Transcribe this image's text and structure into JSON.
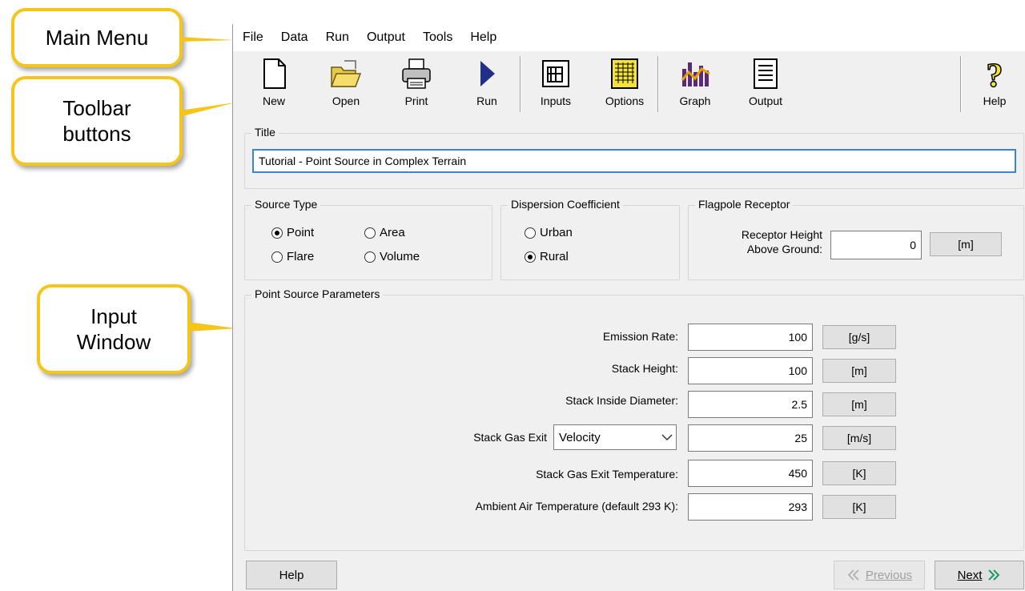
{
  "callouts": {
    "main_menu": "Main Menu",
    "toolbar_line1": "Toolbar",
    "toolbar_line2": "buttons",
    "input_line1": "Input",
    "input_line2": "Window"
  },
  "menu": [
    "File",
    "Data",
    "Run",
    "Output",
    "Tools",
    "Help"
  ],
  "toolbar": {
    "new": "New",
    "open": "Open",
    "print": "Print",
    "run": "Run",
    "inputs": "Inputs",
    "options": "Options",
    "graph": "Graph",
    "output": "Output",
    "help": "Help"
  },
  "title_group": {
    "legend": "Title",
    "value": "Tutorial - Point Source in Complex Terrain"
  },
  "source_type": {
    "legend": "Source Type",
    "point": "Point",
    "area": "Area",
    "flare": "Flare",
    "volume": "Volume",
    "selected": "Point"
  },
  "dispersion": {
    "legend": "Dispersion Coefficient",
    "urban": "Urban",
    "rural": "Rural",
    "selected": "Rural"
  },
  "flagpole": {
    "legend": "Flagpole Receptor",
    "label_line1": "Receptor Height",
    "label_line2": "Above Ground:",
    "value": "0",
    "unit": "[m]"
  },
  "params": {
    "legend": "Point Source Parameters",
    "emission_rate": {
      "label": "Emission Rate:",
      "value": "100",
      "unit": "[g/s]"
    },
    "stack_height": {
      "label": "Stack Height:",
      "value": "100",
      "unit": "[m]"
    },
    "stack_diameter": {
      "label": "Stack Inside Diameter:",
      "value": "2.5",
      "unit": "[m]"
    },
    "stack_exit": {
      "label": "Stack Gas Exit",
      "select_value": "Velocity",
      "value": "25",
      "unit": "[m/s]"
    },
    "exit_temp": {
      "label": "Stack Gas Exit Temperature:",
      "value": "450",
      "unit": "[K]"
    },
    "ambient_temp": {
      "label": "Ambient Air Temperature (default 293 K):",
      "value": "293",
      "unit": "[K]"
    }
  },
  "bottom": {
    "help": "Help",
    "previous": "Previous",
    "next": "Next"
  },
  "colors": {
    "callout_border": "#f5c518",
    "run_arrow": "#1f2f8a",
    "options_yellow": "#f3e23a"
  }
}
